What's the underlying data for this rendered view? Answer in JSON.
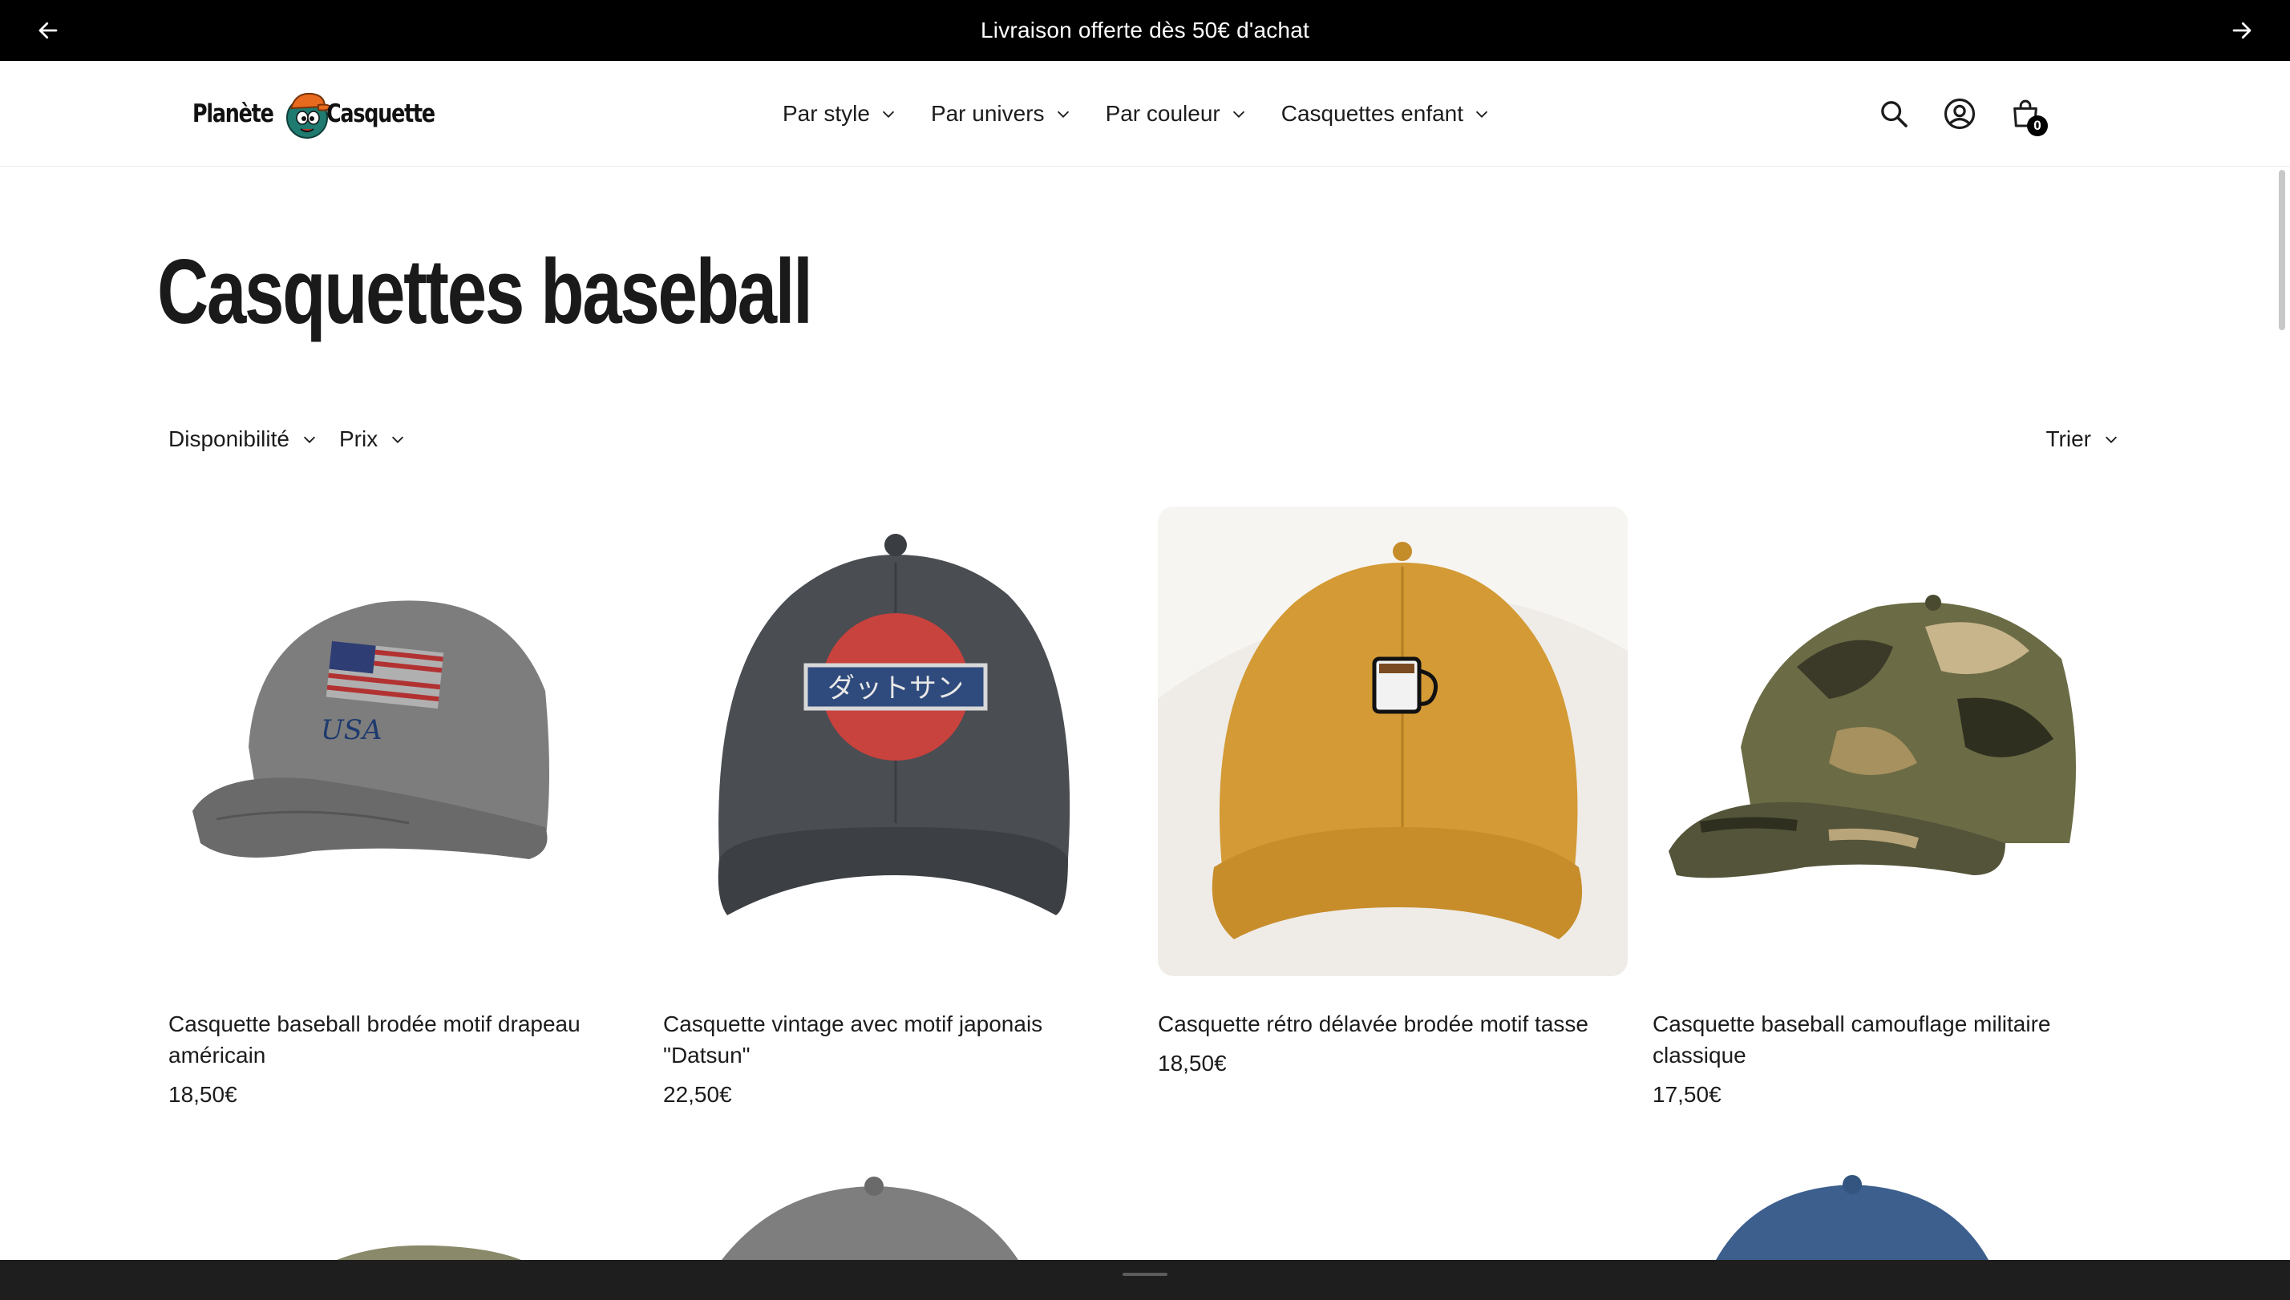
{
  "announcement": {
    "message": "Livraison offerte dès 50€ d'achat"
  },
  "header": {
    "logo": {
      "word1": "Planète",
      "word2": "Casquette"
    },
    "nav": [
      {
        "label": "Par style"
      },
      {
        "label": "Par univers"
      },
      {
        "label": "Par couleur"
      },
      {
        "label": "Casquettes enfant"
      }
    ],
    "cart_count": "0"
  },
  "page": {
    "title": "Casquettes baseball"
  },
  "filters": {
    "availability": "Disponibilité",
    "price": "Prix",
    "sort": "Trier"
  },
  "products": [
    {
      "title": "Casquette baseball brodée motif drapeau américain",
      "price": "18,50€",
      "color": "#7d7d7d"
    },
    {
      "title": "Casquette vintage avec motif japonais \"Datsun\"",
      "price": "22,50€",
      "color": "#4a4d52"
    },
    {
      "title": "Casquette rétro délavée brodée motif tasse",
      "price": "18,50€",
      "color": "#d9a03a"
    },
    {
      "title": "Casquette baseball camouflage militaire classique",
      "price": "17,50€",
      "color": "#5a5a3a"
    }
  ],
  "colors": {
    "accent": "#000000",
    "announce_bg": "#000000",
    "text": "#1c1c1c"
  }
}
